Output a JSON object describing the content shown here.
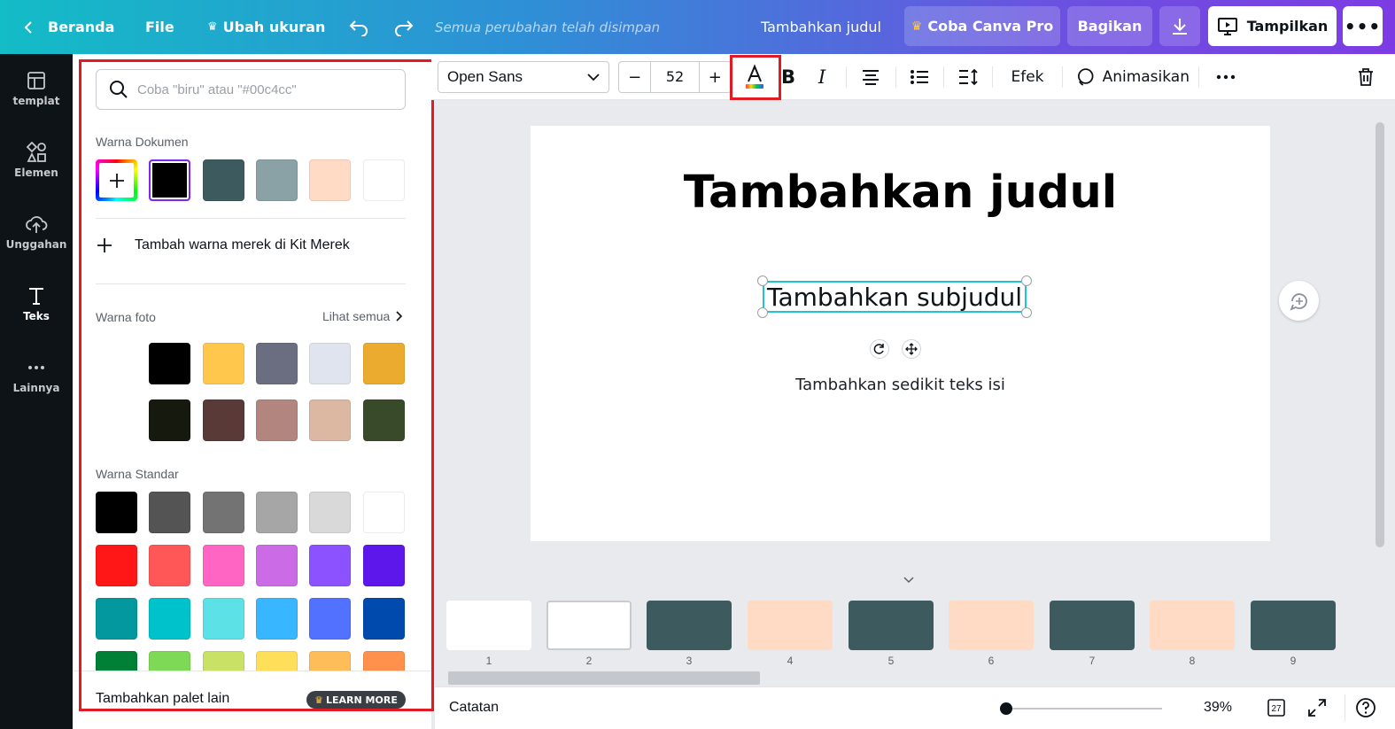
{
  "topbar": {
    "back_label": "Beranda",
    "file_label": "File",
    "resize_label": "Ubah ukuran",
    "saved_status": "Semua perubahan telah disimpan",
    "design_title": "Tambahkan judul",
    "pro_label": "Coba Canva Pro",
    "share_label": "Bagikan",
    "present_label": "Tampilkan"
  },
  "sidebar": {
    "items": [
      {
        "label": "templat",
        "icon": "template-icon"
      },
      {
        "label": "Elemen",
        "icon": "elements-icon"
      },
      {
        "label": "Unggahan",
        "icon": "upload-cloud-icon"
      },
      {
        "label": "Teks",
        "icon": "text-icon"
      },
      {
        "label": "Lainnya",
        "icon": "more-dots-icon"
      }
    ]
  },
  "color_panel": {
    "search_placeholder": "Coba \"biru\" atau \"#00c4cc\"",
    "document_colors_title": "Warna Dokumen",
    "document_colors": [
      "#000000",
      "#3d5a5e",
      "#8aa1a6",
      "#ffdac4",
      "#ffffff"
    ],
    "add_brand_label": "Tambah warna merek di Kit Merek",
    "photo_colors_title": "Warna foto",
    "see_all_label": "Lihat semua",
    "photo_colors": [
      "#000000",
      "#ffc84d",
      "#6b6e80",
      "#dfe4ee",
      "#ebab2e",
      "#161a0e",
      "#5a3a36",
      "#b3857f",
      "#dcb7a2",
      "#394a2a"
    ],
    "standard_colors_title": "Warna Standar",
    "standard_colors": [
      "#000000",
      "#545454",
      "#737373",
      "#a6a6a6",
      "#d9d9d9",
      "#ffffff",
      "#ff1616",
      "#ff5757",
      "#ff66c4",
      "#cb6ce6",
      "#8c52ff",
      "#5e17eb",
      "#03989e",
      "#00c2cb",
      "#5ce1e6",
      "#38b6ff",
      "#5271ff",
      "#004aad",
      "#008037",
      "#7ed957",
      "#c9e265",
      "#ffde59",
      "#ffbd59",
      "#ff914d"
    ],
    "footer_label": "Tambahkan palet lain",
    "learn_more_label": "LEARN MORE"
  },
  "toolbar": {
    "font_name": "Open Sans",
    "font_size": "52",
    "effects_label": "Efek",
    "animate_label": "Animasikan"
  },
  "canvas": {
    "title": "Tambahkan judul",
    "subtitle": "Tambahkan subjudul",
    "body": "Tambahkan sedikit teks isi"
  },
  "pages": [
    {
      "num": "1",
      "bg": "#ffffff"
    },
    {
      "num": "2",
      "bg": "#ffffff"
    },
    {
      "num": "3",
      "bg": "#3d5a5e"
    },
    {
      "num": "4",
      "bg": "#ffdac4"
    },
    {
      "num": "5",
      "bg": "#3d5a5e"
    },
    {
      "num": "6",
      "bg": "#ffdac4"
    },
    {
      "num": "7",
      "bg": "#3d5a5e"
    },
    {
      "num": "8",
      "bg": "#ffdac4"
    },
    {
      "num": "9",
      "bg": "#3d5a5e"
    }
  ],
  "bottombar": {
    "notes_label": "Catatan",
    "zoom": "39%",
    "page_count": "27"
  },
  "colors": {
    "accent_cyan": "#21c3d0",
    "annotation_red": "#e01b24",
    "selected_swatch_border": "#7d2ae8"
  }
}
